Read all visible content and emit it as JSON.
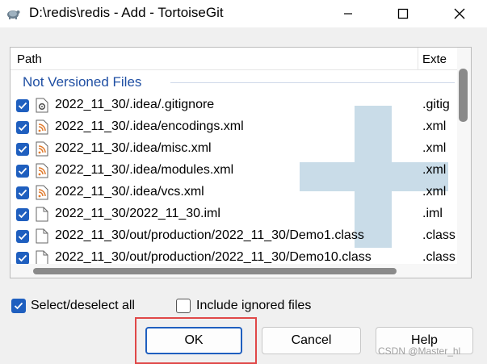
{
  "window": {
    "title": "D:\\redis\\redis - Add - TortoiseGit",
    "icon": "tortoise-icon",
    "controls": {
      "minimize": "minimize-icon",
      "maximize": "maximize-icon",
      "close": "close-icon"
    }
  },
  "list": {
    "columns": {
      "path": "Path",
      "extension": "Exte"
    },
    "group_label": "Not Versioned Files",
    "rows": [
      {
        "path": "2022_11_30/.idea/.gitignore",
        "ext": ".gitig",
        "icon": "gear-file-icon",
        "checked": true
      },
      {
        "path": "2022_11_30/.idea/encodings.xml",
        "ext": ".xml",
        "icon": "xml-file-icon",
        "checked": true
      },
      {
        "path": "2022_11_30/.idea/misc.xml",
        "ext": ".xml",
        "icon": "xml-file-icon",
        "checked": true
      },
      {
        "path": "2022_11_30/.idea/modules.xml",
        "ext": ".xml",
        "icon": "xml-file-icon",
        "checked": true
      },
      {
        "path": "2022_11_30/.idea/vcs.xml",
        "ext": ".xml",
        "icon": "xml-file-icon",
        "checked": true
      },
      {
        "path": "2022_11_30/2022_11_30.iml",
        "ext": ".iml",
        "icon": "blank-file-icon",
        "checked": true
      },
      {
        "path": "2022_11_30/out/production/2022_11_30/Demo1.class",
        "ext": ".class",
        "icon": "blank-file-icon",
        "checked": true
      },
      {
        "path": "2022_11_30/out/production/2022_11_30/Demo10.class",
        "ext": ".class",
        "icon": "blank-file-icon",
        "checked": true
      }
    ]
  },
  "options": {
    "select_all": {
      "label": "Select/deselect all",
      "checked": true
    },
    "include_ignored": {
      "label": "Include ignored files",
      "checked": false
    }
  },
  "buttons": {
    "ok": "OK",
    "cancel": "Cancel",
    "help": "Help"
  },
  "watermark": "CSDN @Master_hl",
  "colors": {
    "accent": "#1f5fbf",
    "group_text": "#1f4fa3",
    "highlight": "#e04848",
    "plus_watermark": "#c9dce8"
  }
}
